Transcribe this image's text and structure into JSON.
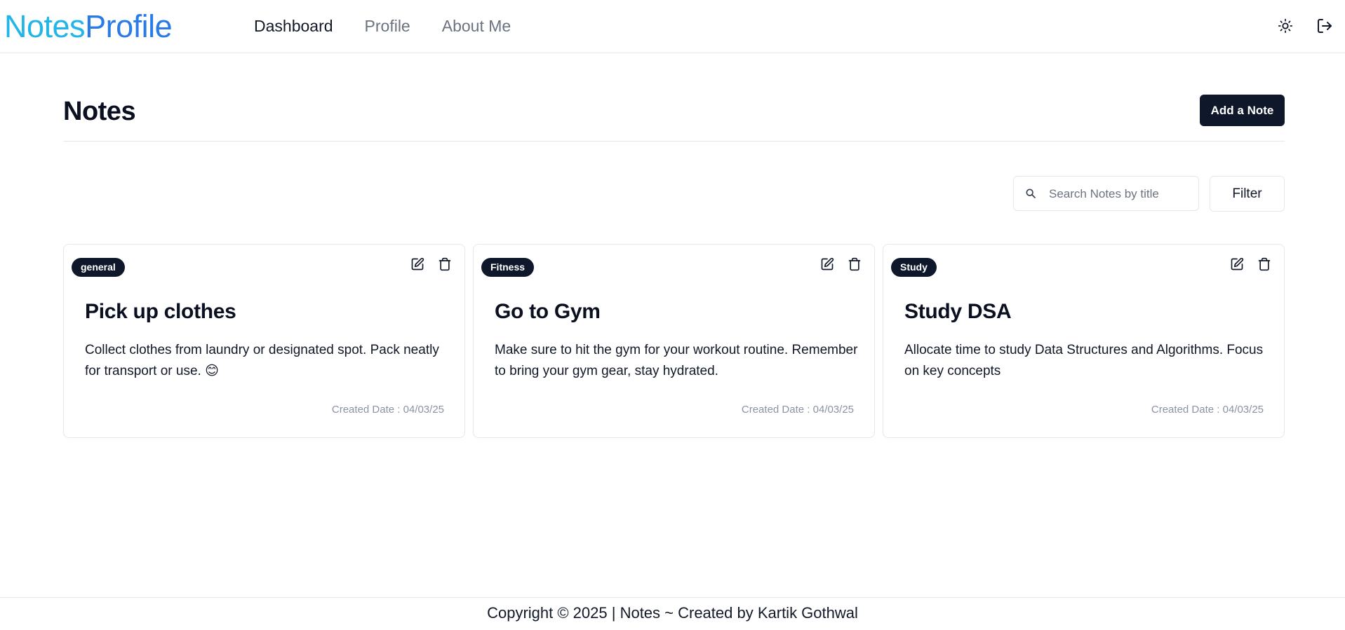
{
  "brand": {
    "part1": "Notes",
    "part2": "Profile"
  },
  "nav": {
    "items": [
      "Dashboard",
      "Profile",
      "About Me"
    ],
    "active": "Dashboard"
  },
  "header": {
    "title": "Notes",
    "add_button": "Add a Note"
  },
  "search": {
    "placeholder": "Search Notes by title",
    "value": ""
  },
  "filter_button": "Filter",
  "notes": [
    {
      "tag": "general",
      "title": "Pick up clothes",
      "description": "Collect clothes from laundry or designated spot. Pack neatly for transport or use. 😊",
      "date": "Created Date : 04/03/25"
    },
    {
      "tag": "Fitness",
      "title": "Go to Gym",
      "description": "Make sure to hit the gym for your workout routine. Remember to bring your gym gear, stay hydrated.",
      "date": "Created Date : 04/03/25"
    },
    {
      "tag": "Study",
      "title": "Study DSA",
      "description": "Allocate time to study Data Structures and Algorithms. Focus on key concepts",
      "date": "Created Date : 04/03/25"
    }
  ],
  "footer": "Copyright © 2025 | Notes ~ Created by Kartik Gothwal",
  "icons": {
    "theme": "sun-icon",
    "logout": "logout-icon",
    "search": "search-icon",
    "edit": "edit-icon",
    "delete": "trash-icon"
  },
  "colors": {
    "brand_start": "#22b5e8",
    "brand_end": "#2b7be6",
    "primary": "#0f172a"
  }
}
